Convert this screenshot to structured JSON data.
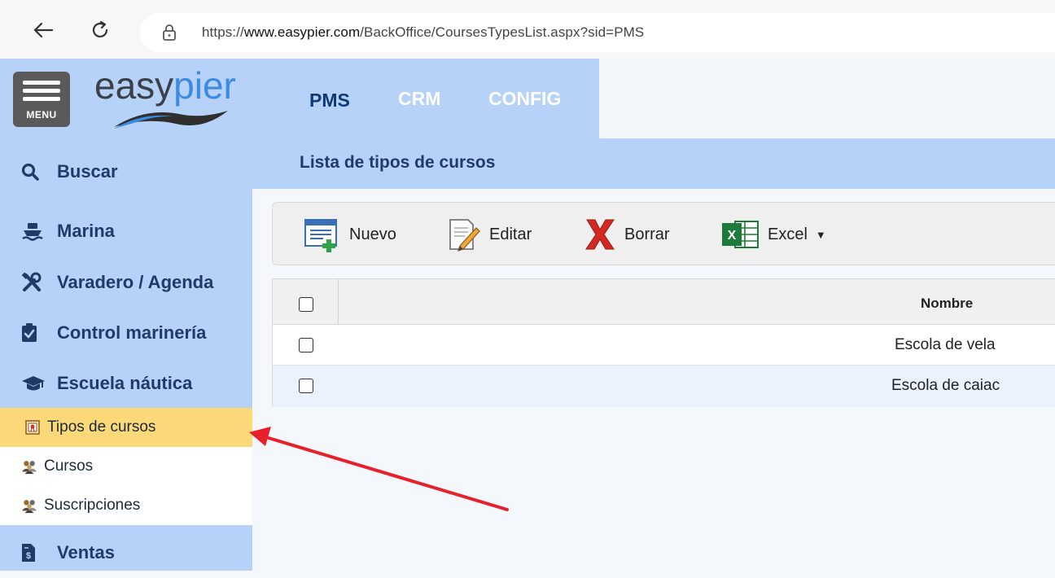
{
  "browser": {
    "url_prefix": "https://",
    "url_domain": "www.easypier.com",
    "url_path": "/BackOffice/CoursesTypesList.aspx?sid=PMS",
    "icons": {
      "back": "arrow-left-icon",
      "reload": "reload-icon",
      "lock": "lock-icon"
    }
  },
  "header": {
    "menu_label": "MENU",
    "logo_part1": "easy",
    "logo_part2": "pier",
    "nav": [
      "PMS",
      "CRM",
      "CONFIG"
    ]
  },
  "sidebar": {
    "items": [
      {
        "label": "Buscar",
        "icon": "search-icon"
      },
      {
        "label": "Marina",
        "icon": "ship-icon"
      },
      {
        "label": "Varadero / Agenda",
        "icon": "tools-icon"
      },
      {
        "label": "Control marinería",
        "icon": "clipboard-check-icon"
      },
      {
        "label": "Escuela náutica",
        "icon": "graduation-cap-icon"
      }
    ],
    "subitems": [
      {
        "label": "Tipos de cursos",
        "icon": "certificate-icon",
        "selected": true
      },
      {
        "label": "Cursos",
        "icon": "people-group-icon"
      },
      {
        "label": "Suscripciones",
        "icon": "people-group-icon"
      }
    ],
    "bottom_item": {
      "label": "Ventas",
      "icon": "invoice-icon"
    }
  },
  "main": {
    "title": "Lista de tipos de cursos",
    "toolbar": {
      "nuevo": "Nuevo",
      "editar": "Editar",
      "borrar": "Borrar",
      "excel": "Excel",
      "caret": "▼"
    },
    "table": {
      "column_nombre": "Nombre",
      "rows": [
        {
          "nombre": "Escola de vela"
        },
        {
          "nombre": "Escola de caiac"
        }
      ]
    }
  },
  "colors": {
    "sidebar_bg": "#b6d2f8",
    "selected_bg": "#fbd978",
    "annotation_arrow": "#e8202a"
  }
}
